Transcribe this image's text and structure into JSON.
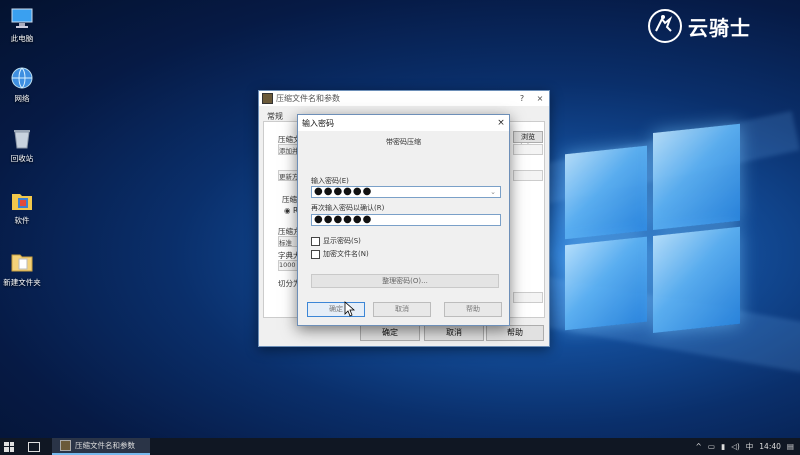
{
  "desktop": {
    "icons": [
      {
        "label": "此电脑",
        "icon": "computer-icon"
      },
      {
        "label": "网络",
        "icon": "network-icon"
      },
      {
        "label": "回收站",
        "icon": "recycle-bin-icon"
      },
      {
        "label": "软件",
        "icon": "software-icon"
      },
      {
        "label": "新建文件夹",
        "icon": "folder-icon"
      }
    ],
    "brand": {
      "text": "云骑士",
      "icon": "knight-logo"
    }
  },
  "back_dialog": {
    "title": "压缩文件名和参数",
    "help_glyph": "?",
    "close_glyph": "×",
    "tab": "常规",
    "labels": [
      "压缩文",
      "浏览(B)...",
      "更新方",
      "压缩文",
      "压缩方",
      "字典大",
      "切分为"
    ],
    "fields": [
      "添加并",
      "标准",
      "1000 K"
    ],
    "radio_label": "R",
    "ok": "确定",
    "cancel": "取消",
    "help": "帮助"
  },
  "password_dialog": {
    "title": "输入密码",
    "close_glyph": "×",
    "subtitle": "带密码压缩",
    "enter_label": "输入密码(E)",
    "enter_value": "●●●●●●",
    "reenter_label": "再次输入密码以确认(R)",
    "reenter_value": "●●●●●●",
    "show_password": "显示密码(S)",
    "encrypt_names": "加密文件名(N)",
    "organize": "整理密码(O)...",
    "ok": "确定",
    "cancel": "取消",
    "help": "帮助"
  },
  "taskbar": {
    "app_label": "压缩文件名和参数",
    "ime": "中",
    "time": "14:40",
    "tray_caret": "^"
  },
  "colors": {
    "accent": "#3c86d6",
    "taskbar": "#101723",
    "dialog_bg": "#f0f0f0"
  }
}
